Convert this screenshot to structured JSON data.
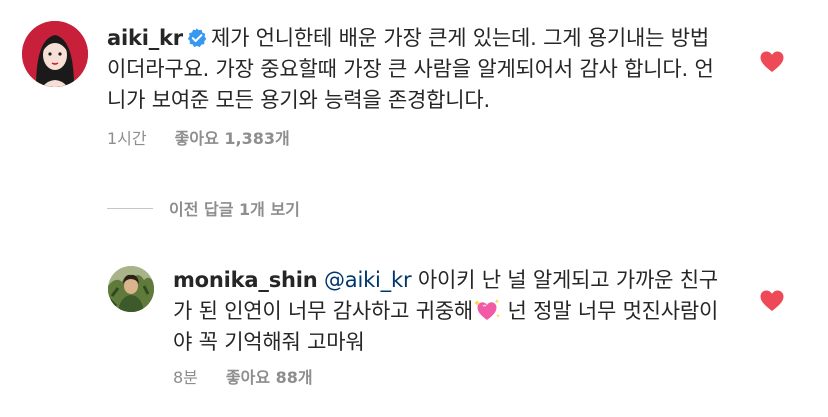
{
  "comments": [
    {
      "username": "aiki_kr",
      "verified": true,
      "text": "제가 언니한테 배운 가장 큰게 있는데. 그게 용기내는 방법이더라구요. 가장 중요할때 가장 큰 사람을 알게되어서 감사 합니다. 언니가 보여준 모든 용기와 능력을 존경합니다.",
      "time": "1시간",
      "likes": "좋아요 1,383개",
      "liked": true
    },
    {
      "username": "monika_shin",
      "mention": "@aiki_kr",
      "text_before_emoji": "아이키 난 널 알게되고 가까운 친구가 된 인연이 너무 감사하고 귀중해",
      "emoji": "sparkling-heart-emoji",
      "text_after_emoji": " 넌 정말 너무 멋진사람이야 꼭 기억해줘 고마워",
      "time": "8분",
      "likes": "좋아요 88개",
      "liked": true
    }
  ],
  "view_replies_label": "이전 답글 1개 보기",
  "colors": {
    "text": "#262626",
    "meta": "#8e8e8e",
    "mention": "#00376b",
    "heart": "#ed4956",
    "verified": "#3897f0"
  }
}
